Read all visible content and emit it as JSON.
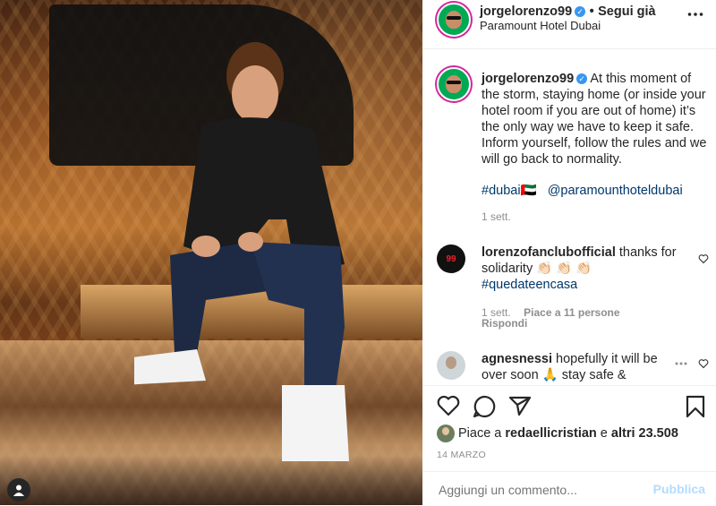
{
  "header": {
    "username": "jorgelorenzo99",
    "separator": "•",
    "follow_label": "Segui già",
    "location": "Paramount Hotel Dubai",
    "more_icon": "more-horizontal-icon"
  },
  "caption": {
    "username": "jorgelorenzo99",
    "text": "At this moment of the storm, staying home (or inside your hotel room if you are out of home) it’s the only way we have to keep it safe. Inform yourself, follow the rules and we will go back to normality.",
    "hashtag": "#dubai🇦🇪",
    "mention": "@paramounthoteldubai",
    "time": "1 sett."
  },
  "comments": [
    {
      "username": "lorenzofanclubofficial",
      "text": "thanks for solidarity 👏🏻 👏🏻 👏🏻",
      "hashtag": "#quedateencasa",
      "time": "1 sett.",
      "likes": "Piace a 11 persone",
      "reply": "Rispondi"
    },
    {
      "username": "agnesnessi",
      "text": "hopefully it will be over soon 🙏  stay safe & healthy"
    }
  ],
  "likes": {
    "prefix": "Piace a",
    "user": "redaellicristian",
    "conj": "e",
    "others": "altri 23.508"
  },
  "date": "14 MARZO",
  "comment_box": {
    "placeholder": "Aggiungi un commento...",
    "submit": "Pubblica"
  },
  "colors": {
    "link": "#00376b",
    "muted": "#8e8e8e",
    "verified": "#3897f0",
    "submit_disabled": "#b3dbff"
  }
}
